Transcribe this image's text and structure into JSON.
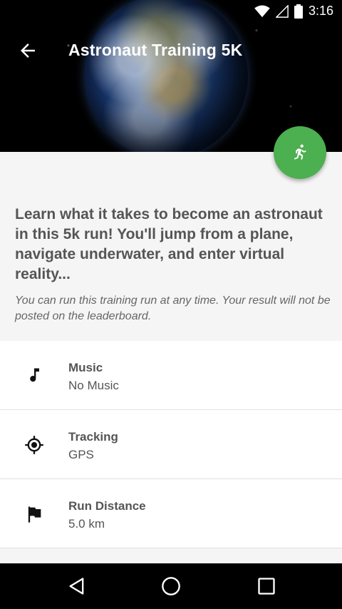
{
  "status_bar": {
    "time": "3:16"
  },
  "toolbar": {
    "title": "Astronaut Training 5K"
  },
  "intro": {
    "description": "Learn what it takes to become an astronaut in this 5k run! You'll jump from a plane, navigate underwater, and enter virtual reality...",
    "note": "You can run this training run at any time. Your result will not be posted on the leaderboard."
  },
  "settings": [
    {
      "label": "Music",
      "value": "No Music",
      "icon": "music-note-icon"
    },
    {
      "label": "Tracking",
      "value": "GPS",
      "icon": "gps-target-icon"
    },
    {
      "label": "Run Distance",
      "value": "5.0 km",
      "icon": "flag-icon"
    }
  ],
  "colors": {
    "fab": "#4caf50",
    "header_bg": "#000000",
    "body_bg": "#f5f5f5"
  },
  "nav": {
    "icons": [
      "back-triangle-icon",
      "home-circle-icon",
      "recents-square-icon"
    ]
  }
}
